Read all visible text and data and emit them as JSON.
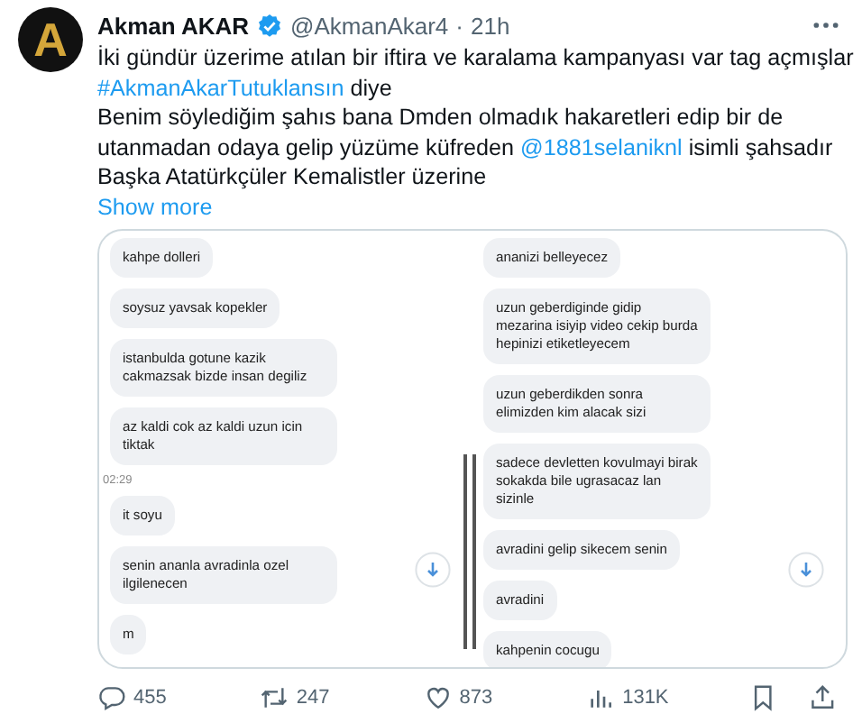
{
  "tweet": {
    "avatar_letter": "A",
    "name": "Akman AKAR",
    "verified": true,
    "handle": "@AkmanAkar4",
    "separator": "·",
    "time": "21h",
    "lines": [
      {
        "parts": [
          {
            "kind": "text",
            "text": "İki gündür üzerime atılan bir iftira ve karalama kampanyası var tag açmışlar"
          }
        ]
      },
      {
        "parts": [
          {
            "kind": "link",
            "text": "#AkmanAkarTutuklansın"
          },
          {
            "kind": "text",
            "text": " diye"
          }
        ]
      },
      {
        "parts": [
          {
            "kind": "text",
            "text": "Benim söylediğim şahıs bana Dmden olmadık hakaretleri edip bir de"
          }
        ]
      },
      {
        "parts": [
          {
            "kind": "text",
            "text": "utanmadan odaya gelip yüzüme küfreden "
          },
          {
            "kind": "link",
            "text": "@1881selaniknl"
          },
          {
            "kind": "text",
            "text": " isimli şahsadır"
          }
        ]
      },
      {
        "parts": [
          {
            "kind": "text",
            "text": "Başka Atatürkçüler Kemalistler üzerine"
          }
        ]
      }
    ],
    "show_more": "Show more",
    "image_panes": [
      {
        "items": [
          {
            "kind": "bubble",
            "text": "kahpe dolleri"
          },
          {
            "kind": "bubble",
            "text": "soysuz yavsak kopekler"
          },
          {
            "kind": "bubble",
            "text": "istanbulda gotune kazik cakmazsak bizde insan degiliz"
          },
          {
            "kind": "bubble",
            "text": "az kaldi cok az kaldi uzun icin tiktak"
          },
          {
            "kind": "time",
            "text": "02:29"
          },
          {
            "kind": "bubble",
            "text": "it soyu"
          },
          {
            "kind": "bubble",
            "text": "senin ananla avradinla ozel ilgilenecen"
          },
          {
            "kind": "bubble",
            "text": "m"
          }
        ]
      },
      {
        "items": [
          {
            "kind": "bubble",
            "text": "ananizi belleyecez"
          },
          {
            "kind": "bubble",
            "text": "uzun geberdiginde gidip mezarina isiyip video cekip burda hepinizi etiketleyecem"
          },
          {
            "kind": "bubble",
            "text": "uzun geberdikden sonra elimizden kim alacak sizi"
          },
          {
            "kind": "bubble",
            "text": "sadece devletten kovulmayi birak sokakda bile ugrasacaz lan sizinle"
          },
          {
            "kind": "bubble",
            "text": "avradini gelip sikecem senin"
          },
          {
            "kind": "bubble",
            "text": "avradini"
          },
          {
            "kind": "bubble",
            "text": "kahpenin cocugu"
          }
        ]
      }
    ],
    "actions": [
      {
        "kind": "reply",
        "count": "455"
      },
      {
        "kind": "repost",
        "count": "247"
      },
      {
        "kind": "like",
        "count": "873"
      },
      {
        "kind": "views",
        "count": "131K"
      },
      {
        "kind": "bookmark"
      },
      {
        "kind": "share"
      }
    ]
  }
}
